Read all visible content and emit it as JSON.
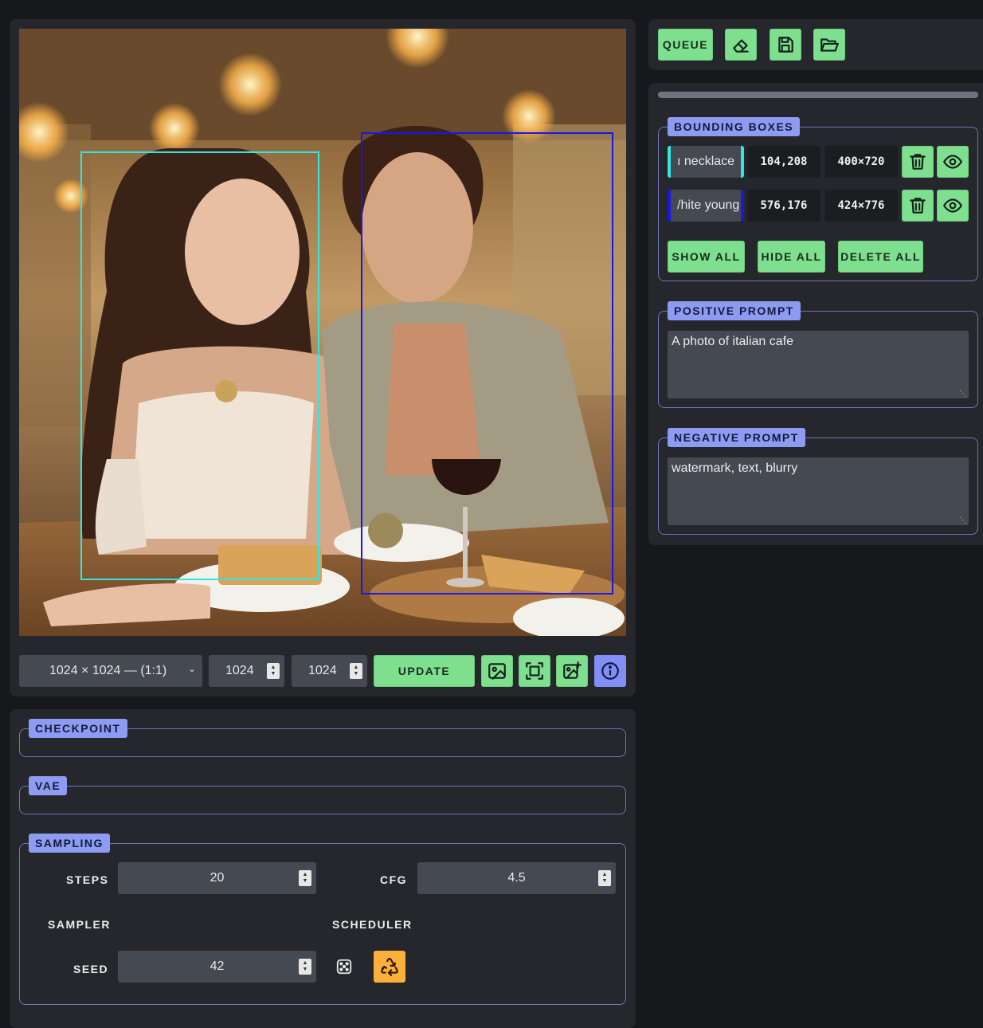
{
  "toolbar": {
    "queue_label": "QUEUE",
    "icons": [
      "eraser-icon",
      "save-icon",
      "folder-open-icon"
    ]
  },
  "preview": {
    "boxes": [
      {
        "color": "#2fe8e4"
      },
      {
        "color": "#1a16e6"
      }
    ]
  },
  "resolution": {
    "preset": "1024 × 1024 — (1:1)",
    "width": "1024",
    "height": "1024",
    "update_label": "UPDATE"
  },
  "bounding_boxes": {
    "title": "BOUNDING BOXES",
    "rows": [
      {
        "prompt": "ı necklace",
        "pos": "104,208",
        "size": "400×720",
        "color": "#2fe8e4"
      },
      {
        "prompt": "/hite young",
        "pos": "576,176",
        "size": "424×776",
        "color": "#1a16e6"
      }
    ],
    "show_all": "SHOW ALL",
    "hide_all": "HIDE ALL",
    "delete_all": "DELETE ALL"
  },
  "positive_prompt": {
    "title": "POSITIVE PROMPT",
    "value": "A photo of italian cafe"
  },
  "negative_prompt": {
    "title": "NEGATIVE PROMPT",
    "value": "watermark, text, blurry"
  },
  "checkpoint": {
    "title": "CHECKPOINT"
  },
  "vae": {
    "title": "VAE"
  },
  "sampling": {
    "title": "SAMPLING",
    "steps_label": "STEPS",
    "steps": "20",
    "cfg_label": "CFG",
    "cfg": "4.5",
    "sampler_label": "SAMPLER",
    "scheduler_label": "SCHEDULER",
    "seed_label": "SEED",
    "seed": "42"
  },
  "colors": {
    "accent_green": "#7ee08f",
    "accent_blue": "#8d9cf2",
    "accent_orange": "#fbb03b"
  }
}
